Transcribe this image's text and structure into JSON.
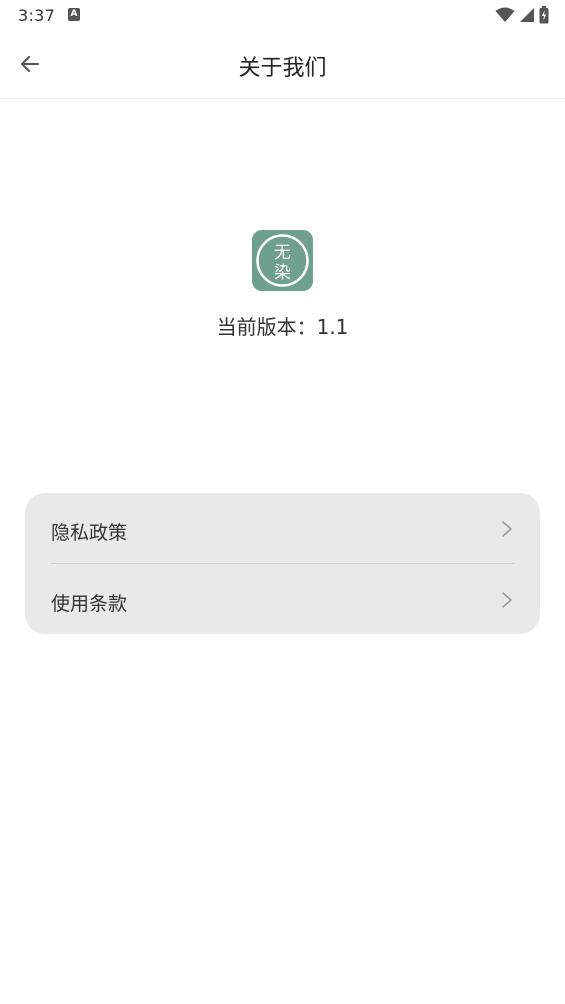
{
  "status_bar": {
    "time": "3:37",
    "notification_icon": "A",
    "icons": [
      "wifi-icon",
      "signal-icon",
      "battery-charging-icon"
    ]
  },
  "app_bar": {
    "title": "关于我们",
    "back_icon": "arrow-left-icon"
  },
  "app_logo": {
    "text_top": "无",
    "text_bottom": "染",
    "color": "#6f9f8e"
  },
  "version": {
    "text": "当前版本：1.1"
  },
  "menu": {
    "items": [
      {
        "label": "隐私政策",
        "icon": "chevron-right-icon"
      },
      {
        "label": "使用条款",
        "icon": "chevron-right-icon"
      }
    ]
  },
  "colors": {
    "background": "#ffffff",
    "card": "#e9e9e9",
    "logo": "#6f9f8e",
    "text": "#333333"
  }
}
